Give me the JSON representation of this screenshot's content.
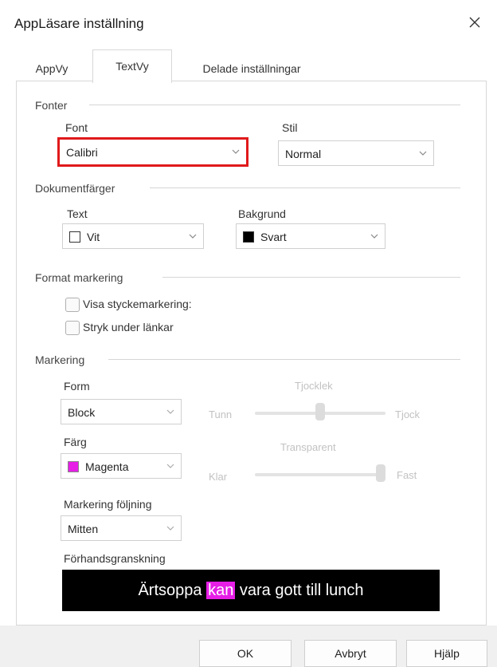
{
  "window": {
    "title": "AppLäsare inställning"
  },
  "tabs": [
    {
      "label": "AppVy"
    },
    {
      "label": "TextVy"
    },
    {
      "label": "Delade inställningar"
    }
  ],
  "fonts": {
    "group_label": "Fonter",
    "font_label": "Font",
    "font_value": "Calibri",
    "style_label": "Stil",
    "style_value": "Normal"
  },
  "doc_colors": {
    "group_label": "Dokumentfärger",
    "text_label": "Text",
    "text_value": "Vit",
    "text_swatch": "#ffffff",
    "bg_label": "Bakgrund",
    "bg_value": "Svart",
    "bg_swatch": "#000000"
  },
  "format_marking": {
    "group_label": "Format markering",
    "show_paragraph": "Visa styckemarkering:",
    "underline_links": "Stryk under länkar"
  },
  "marking": {
    "group_label": "Markering",
    "form_label": "Form",
    "form_value": "Block",
    "thickness_label": "Tjocklek",
    "thin_label": "Tunn",
    "thick_label": "Tjock",
    "thickness_level": 0.5,
    "color_label": "Färg",
    "color_value": "Magenta",
    "color_swatch": "#e61ee6",
    "transparent_label": "Transparent",
    "clear_label": "Klar",
    "solid_label": "Fast",
    "transparency_level": 1.0,
    "follow_label": "Markering följning",
    "follow_value": "Mitten",
    "preview_label": "Förhandsgranskning",
    "preview_before": "Ärtsoppa ",
    "preview_highlight": "kan",
    "preview_after": " vara gott till lunch"
  },
  "buttons": {
    "ok": "OK",
    "cancel": "Avbryt",
    "help": "Hjälp"
  }
}
